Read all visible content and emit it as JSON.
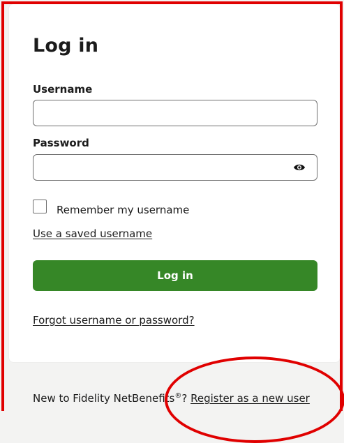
{
  "login": {
    "title": "Log in",
    "username_label": "Username",
    "username_value": "",
    "password_label": "Password",
    "password_value": "",
    "show_password_icon": "eye-icon",
    "remember_label": "Remember my username",
    "remember_checked": false,
    "saved_username_link": "Use a saved username",
    "submit_label": "Log in",
    "forgot_link": "Forgot username or password?"
  },
  "footer": {
    "prefix": "New to Fidelity NetBenefits",
    "trademark": "®",
    "separator": "? ",
    "register_link": "Register as a new user"
  },
  "colors": {
    "primary_button": "#368727",
    "annotation": "#e00000",
    "page_background": "#f3f3f2"
  }
}
